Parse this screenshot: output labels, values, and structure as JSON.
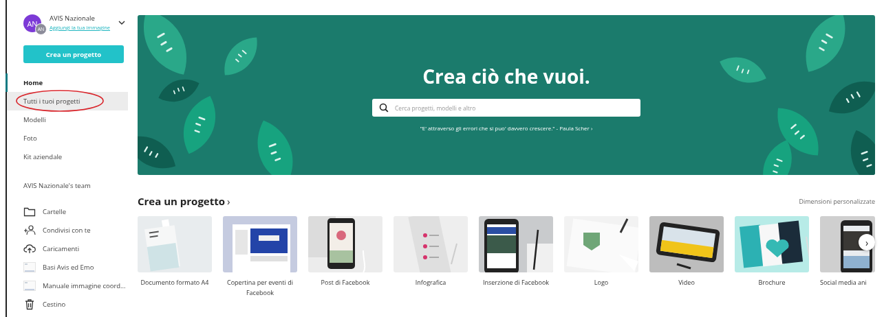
{
  "account": {
    "initials": "AN",
    "badge_initials": "AN",
    "name": "AVIS Nazionale",
    "link": "Aggiungi la tua immagine"
  },
  "create_button": "Crea un progetto",
  "nav": [
    {
      "label": "Home",
      "selected": true,
      "hovered": false
    },
    {
      "label": "Tutti i tuoi progetti",
      "selected": false,
      "hovered": true,
      "circled": true
    },
    {
      "label": "Modelli",
      "selected": false,
      "hovered": false
    },
    {
      "label": "Foto",
      "selected": false,
      "hovered": false
    },
    {
      "label": "Kit aziendale",
      "selected": false,
      "hovered": false
    }
  ],
  "team": "AVIS Nazionale's team",
  "folders": [
    {
      "kind": "folder",
      "label": "Cartelle"
    },
    {
      "kind": "shared",
      "label": "Condivisi con te"
    },
    {
      "kind": "upload",
      "label": "Caricamenti"
    },
    {
      "kind": "file",
      "label": "Basi Avis ed Emo"
    },
    {
      "kind": "file",
      "label": "Manuale immagine coord..."
    },
    {
      "kind": "trash",
      "label": "Cestino"
    }
  ],
  "banner": {
    "title": "Crea ciò che vuoi.",
    "search_placeholder": "Cerca progetti, modelli e altro",
    "quote": "\"E' attraverso gli errori che si puo' davvero crescere.\" - Paula Scher ›"
  },
  "section": {
    "title": "Crea un progetto",
    "arrow": "›",
    "link": "Dimensioni personalizzate"
  },
  "templates": [
    {
      "label": "Documento formato A4",
      "kind": "picture"
    },
    {
      "label": "Copertina per eventi di Facebook",
      "kind": "picture"
    },
    {
      "label": "Post di Facebook",
      "kind": "picture"
    },
    {
      "label": "Infografica",
      "kind": "picture"
    },
    {
      "label": "Inserzione di Facebook",
      "kind": "picture"
    },
    {
      "label": "Logo",
      "kind": "picture"
    },
    {
      "label": "Video",
      "kind": "picture"
    },
    {
      "label": "Brochure",
      "kind": "picture"
    },
    {
      "label": "Social media ani",
      "kind": "picture"
    }
  ],
  "next_button": "›"
}
